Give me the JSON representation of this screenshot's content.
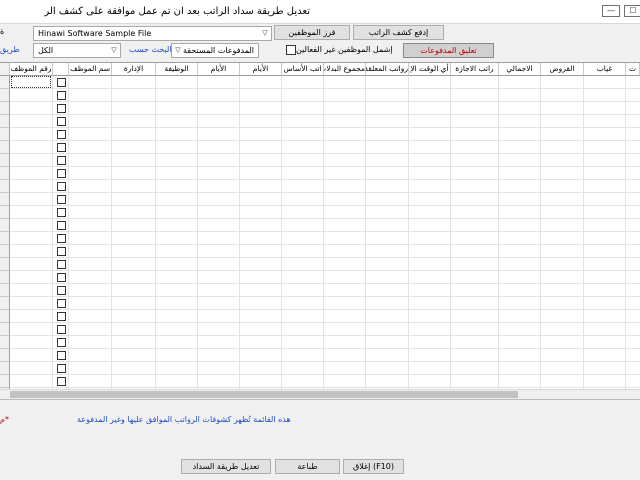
{
  "window": {
    "title": "تعديل طريقة سداد الراتب بعد ان تم عمل موافقة على كشف الر",
    "minimize_label": "—",
    "maximize_label": "☐"
  },
  "toolbar": {
    "pay_payroll_label": "إدفع كشف الراتب",
    "sort_employees_label": "فرز الموظفين",
    "payment_suspend_label": "تعليق المدفوعات",
    "company_combo_value": "Hinawi Software Sample File",
    "filter_combo_value": "الكل",
    "due_payments_combo_value": "المدفوعات المستحقة",
    "search_by_label": "البحث حسب",
    "include_inactive_label": "إشمل الموظفين غير الفعالين",
    "left_edge_label": "طريق"
  },
  "grid": {
    "columns": [
      "رقم الموظف",
      "",
      "سم الموظف",
      "الإدارة",
      "الوظيفة",
      "الأيام",
      "الأيام",
      "اتب الأساس",
      "مجموع البدلات",
      "رواتب المعلقة",
      "أي الوقت الإ",
      "راتب الاجازة",
      "الاجمالي",
      "القروض",
      "غياب",
      "ت"
    ],
    "row_count": 25
  },
  "footer": {
    "note_text": "هذه القائمة تُظهر كشوفات الرواتب الموافق عليها وغير المدفوعة",
    "note_marker": "*م",
    "edit_payment_label": "تعديل طريقة السداد",
    "print_label": "طباعة",
    "close_label": "(F10) إغلاق"
  },
  "colors": {
    "accent_blue": "#1f4fc9",
    "accent_red": "#c00000"
  }
}
